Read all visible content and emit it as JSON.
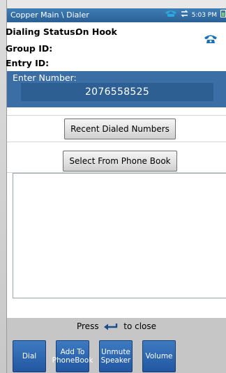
{
  "titlebar": {
    "title": "Copper Main \\ Dialer",
    "time": "5:03 PM",
    "icons": [
      "phone-icon",
      "sync-arrows-icon",
      "battery-icon"
    ]
  },
  "status": {
    "dialing_status_label": "Dialing Status:",
    "dialing_status_value": "On Hook",
    "group_id_label": "Group ID:",
    "group_id_value": "",
    "entry_id_label": "Entry ID:",
    "entry_id_value": "",
    "status_icon": "phone-on-hook-icon"
  },
  "enter_number": {
    "label": "Enter Number:",
    "value": "2076558525"
  },
  "buttons": {
    "recent": "Recent Dialed Numbers",
    "phonebook": "Select From Phone Book"
  },
  "footer": {
    "press_before": "Press",
    "press_after": "to close",
    "return_icon": "return-arrow-icon"
  },
  "softkeys": [
    "Dial",
    "Add To PhoneBook",
    "Unmute Speaker",
    "Volume"
  ],
  "colors": {
    "titlebar": "#2f6aa3",
    "accent_panel": "#3b6ea4",
    "softkey": "#2f66b0",
    "icon_blue": "#1a6fb5"
  }
}
